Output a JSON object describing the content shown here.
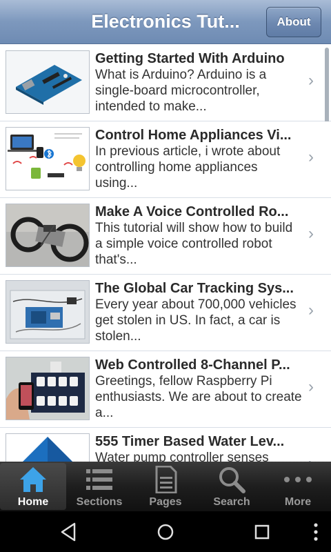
{
  "header": {
    "title": "Electronics Tut...",
    "about_label": "About"
  },
  "articles": [
    {
      "title": "Getting Started With Arduino",
      "description": "What is Arduino? Arduino is a single-board microcontroller, intended to make...",
      "thumb_icon": "arduino-board-image"
    },
    {
      "title": "Control Home Appliances Vi...",
      "description": "In previous article, i wrote about controlling home appliances using...",
      "thumb_icon": "home-appliances-diagram-image"
    },
    {
      "title": "Make A Voice Controlled Ro...",
      "description": "This tutorial will show how to build a simple voice controlled robot that's...",
      "thumb_icon": "robot-image"
    },
    {
      "title": "The Global Car Tracking Sys...",
      "description": "Every year about 700,000 vehicles get stolen in US. In fact, a car is stolen...",
      "thumb_icon": "car-tracker-circuit-image"
    },
    {
      "title": "Web Controlled 8-Channel P...",
      "description": "Greetings, fellow Raspberry Pi enthusiasts.  We are about to create a...",
      "thumb_icon": "power-strip-image"
    },
    {
      "title": "555 Timer Based Water Lev...",
      "description": "Water pump controller senses",
      "thumb_icon": "water-tank-image"
    }
  ],
  "tabs": [
    {
      "label": "Home",
      "icon": "home-icon",
      "active": true
    },
    {
      "label": "Sections",
      "icon": "list-icon",
      "active": false
    },
    {
      "label": "Pages",
      "icon": "document-icon",
      "active": false
    },
    {
      "label": "Search",
      "icon": "search-icon",
      "active": false
    },
    {
      "label": "More",
      "icon": "more-icon",
      "active": false
    }
  ],
  "system_nav": [
    "back-icon",
    "home-circle-icon",
    "recents-icon",
    "overflow-menu-icon"
  ],
  "colors": {
    "header": "#7d98bd",
    "tabbar": "#1e1e1e",
    "active_tab_icon": "#3da3e8"
  }
}
